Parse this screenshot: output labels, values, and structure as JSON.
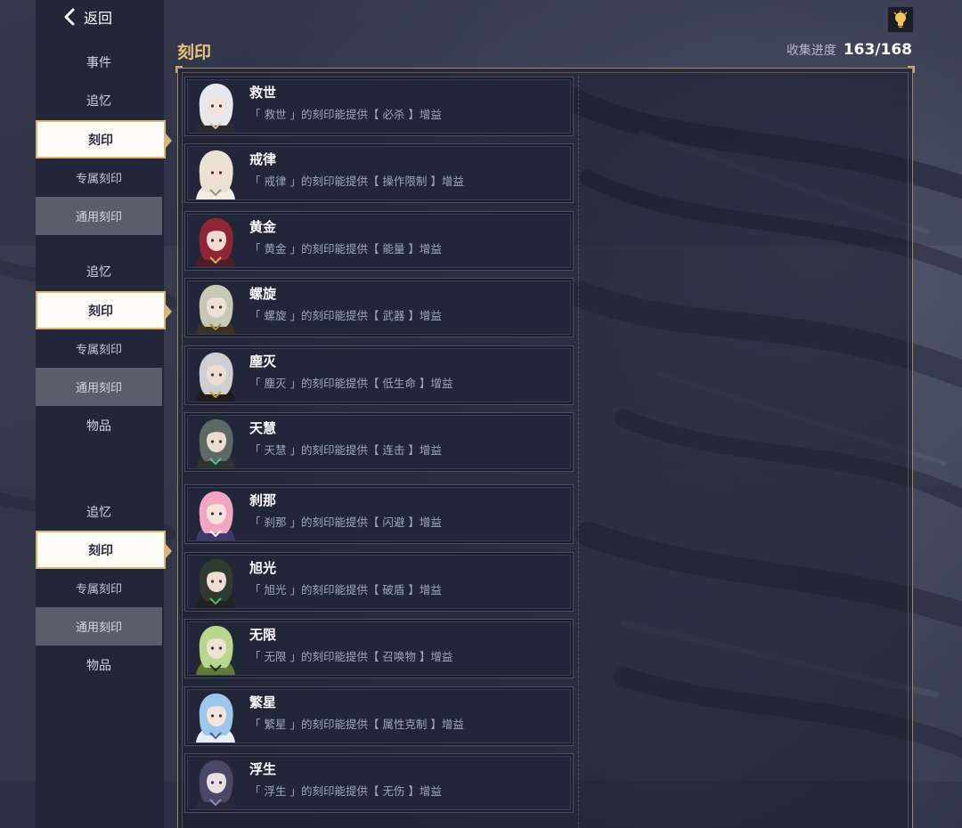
{
  "header": {
    "back_label": "返回",
    "title": "刻印",
    "progress_label": "收集进度",
    "progress_value": "163/168"
  },
  "sidebar": {
    "groups": [
      [
        "事件",
        "追忆",
        "刻印",
        "专属刻印",
        "通用刻印"
      ],
      [
        "追忆",
        "刻印",
        "专属刻印",
        "通用刻印",
        "物品"
      ],
      [
        "追忆",
        "刻印",
        "专属刻印",
        "通用刻印",
        "物品"
      ]
    ]
  },
  "cards": [
    {
      "name": "救世",
      "desc": "「 救世 」的刻印能提供【 必杀 】增益",
      "hair": "#e6e8ee",
      "skin": "#f3e3d9",
      "cloth": "#2a2a30",
      "accent": "#d8c9a2"
    },
    {
      "name": "戒律",
      "desc": "「 戒律 」的刻印能提供【 操作限制 】增益",
      "hair": "#e9e1d2",
      "skin": "#f1dfd3",
      "cloth": "#f2ede3",
      "accent": "#9a8f7a"
    },
    {
      "name": "黄金",
      "desc": "「 黄金 」的刻印能提供【 能量 】增益",
      "hair": "#8e2638",
      "skin": "#f2dad0",
      "cloth": "#4a1e2c",
      "accent": "#d7b25a"
    },
    {
      "name": "螺旋",
      "desc": "「 螺旋 」的刻印能提供【 武器 】增益",
      "hair": "#c9c8b4",
      "skin": "#efe0d4",
      "cloth": "#3c3326",
      "accent": "#a48a48"
    },
    {
      "name": "塵灭",
      "desc": "「 塵灭 」的刻印能提供【 低生命 】增益",
      "hair": "#cfcfd3",
      "skin": "#ecdcd2",
      "cloth": "#201c1e",
      "accent": "#d09a3a"
    },
    {
      "name": "天慧",
      "desc": "「 天慧 」的刻印能提供【 连击 】增益",
      "hair": "#5c6a63",
      "skin": "#eadcd1",
      "cloth": "#2a3532",
      "accent": "#53c3a6"
    },
    {
      "name": "刹那",
      "desc": "「 刹那 」的刻印能提供【 闪避 】增益",
      "hair": "#f3a6c4",
      "skin": "#f6e3da",
      "cloth": "#3d3a6a",
      "accent": "#ffffff"
    },
    {
      "name": "旭光",
      "desc": "「 旭光 」的刻印能提供【 破盾 】增益",
      "hair": "#2f3b2f",
      "skin": "#f0ddd2",
      "cloth": "#1f2420",
      "accent": "#58b56a"
    },
    {
      "name": "无限",
      "desc": "「 无限 」的刻印能提供【 召唤物 】增益",
      "hair": "#b8d68c",
      "skin": "#eee3d2",
      "cloth": "#5f7b3a",
      "accent": "#2b2b22"
    },
    {
      "name": "繁星",
      "desc": "「 繁星 」的刻印能提供【 属性克制 】增益",
      "hair": "#9cc6ea",
      "skin": "#f4e4dc",
      "cloth": "#e7eef6",
      "accent": "#4a5a9a"
    },
    {
      "name": "浮生",
      "desc": "「 浮生 」的刻印能提供【 无伤 】增益",
      "hair": "#4a4866",
      "skin": "#eadfe0",
      "cloth": "#2a2a3e",
      "accent": "#9a86c8"
    }
  ],
  "colors": {
    "title_gold": "#e9c27f",
    "active_border": "#d8b77a",
    "panel_border": "#9c8a66",
    "card_desc": "#9ea6c3"
  },
  "icons": {
    "back": "chevron-left-icon",
    "hint": "lightbulb-icon"
  }
}
